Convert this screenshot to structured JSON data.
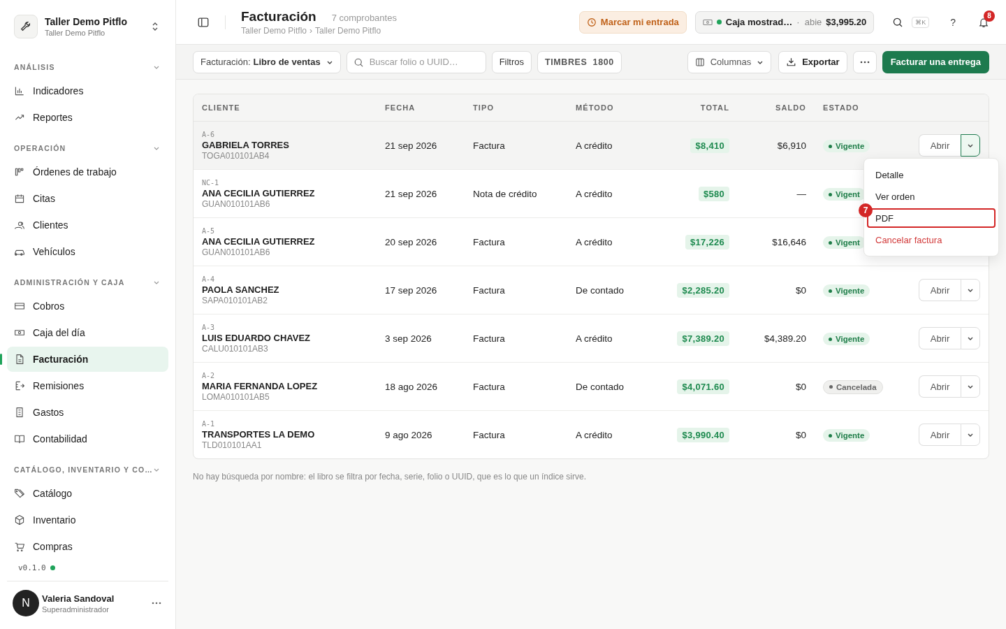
{
  "workspace": {
    "name": "Taller Demo Pitflo",
    "subtitle": "Taller Demo Pitflo"
  },
  "sidebar": {
    "sections": [
      {
        "title": "ANÁLISIS",
        "expanded": true,
        "items": [
          {
            "label": "Indicadores",
            "selected": false
          },
          {
            "label": "Reportes",
            "selected": false
          }
        ]
      },
      {
        "title": "OPERACIÓN",
        "expanded": true,
        "items": [
          {
            "label": "Órdenes de trabajo",
            "selected": false
          },
          {
            "label": "Citas",
            "selected": false
          },
          {
            "label": "Clientes",
            "selected": false
          },
          {
            "label": "Vehículos",
            "selected": false
          }
        ]
      },
      {
        "title": "ADMINISTRACIÓN Y CAJA",
        "expanded": true,
        "items": [
          {
            "label": "Cobros",
            "selected": false
          },
          {
            "label": "Caja del día",
            "selected": false
          },
          {
            "label": "Facturación",
            "selected": true
          },
          {
            "label": "Remisiones",
            "selected": false
          },
          {
            "label": "Gastos",
            "selected": false
          },
          {
            "label": "Contabilidad",
            "selected": false
          }
        ]
      },
      {
        "title": "CATÁLOGO, INVENTARIO Y CO…",
        "expanded": true,
        "items": [
          {
            "label": "Catálogo",
            "selected": false
          },
          {
            "label": "Inventario",
            "selected": false
          },
          {
            "label": "Compras",
            "selected": false
          }
        ]
      }
    ],
    "version": "v0.1.0",
    "user": {
      "initial": "N",
      "name": "Valeria Sandoval",
      "role": "Superadministrador"
    }
  },
  "header": {
    "title": "Facturación",
    "count": "7 comprobantes",
    "breadcrumb": [
      "Taller Demo Pitflo",
      "Taller Demo Pitflo"
    ],
    "breadcrumb_separator": "›",
    "clock_in": "Marcar mi entrada",
    "register": {
      "name": "Caja mostrad…",
      "separator": "·",
      "status": "abie",
      "amount": "$3,995.20"
    },
    "shortcut": "⌘K",
    "help": "?",
    "notifications": "8"
  },
  "toolbar": {
    "view_label": "Facturación:",
    "view_value": "Libro de ventas",
    "search": {
      "placeholder": "Buscar folio o UUID…"
    },
    "filters": "Filtros",
    "stamps_label": "TIMBRES",
    "stamps_value": "1800",
    "columns": "Columnas",
    "export": "Exportar",
    "primary": "Facturar una entrega"
  },
  "table": {
    "columns": [
      "CLIENTE",
      "FECHA",
      "TIPO",
      "MÉTODO",
      "TOTAL",
      "SALDO",
      "ESTADO"
    ],
    "rows": [
      {
        "folio": "A-6",
        "client": "GABRIELA TORRES",
        "rfc": "TOGA010101AB4",
        "date": "21 sep 2026",
        "type": "Factura",
        "method": "A crédito",
        "total": "$8,410",
        "balance": "$6,910",
        "status": "Vigente",
        "cancelled": false,
        "selected": true,
        "open": "Abrir"
      },
      {
        "folio": "NC-1",
        "client": "ANA CECILIA GUTIERREZ",
        "rfc": "GUAN010101AB6",
        "date": "21 sep 2026",
        "type": "Nota de crédito",
        "method": "A crédito",
        "total": "$580",
        "balance": "—",
        "status": "Vigent",
        "cancelled": false,
        "selected": false
      },
      {
        "folio": "A-5",
        "client": "ANA CECILIA GUTIERREZ",
        "rfc": "GUAN010101AB6",
        "date": "20 sep 2026",
        "type": "Factura",
        "method": "A crédito",
        "total": "$17,226",
        "balance": "$16,646",
        "status": "Vigent",
        "cancelled": false,
        "selected": false
      },
      {
        "folio": "A-4",
        "client": "PAOLA SANCHEZ",
        "rfc": "SAPA010101AB2",
        "date": "17 sep 2026",
        "type": "Factura",
        "method": "De contado",
        "total": "$2,285.20",
        "balance": "$0",
        "status": "Vigente",
        "cancelled": false,
        "selected": false,
        "open": "Abrir"
      },
      {
        "folio": "A-3",
        "client": "LUIS EDUARDO CHAVEZ",
        "rfc": "CALU010101AB3",
        "date": "3 sep 2026",
        "type": "Factura",
        "method": "A crédito",
        "total": "$7,389.20",
        "balance": "$4,389.20",
        "status": "Vigente",
        "cancelled": false,
        "selected": false,
        "open": "Abrir"
      },
      {
        "folio": "A-2",
        "client": "MARIA FERNANDA LOPEZ",
        "rfc": "LOMA010101AB5",
        "date": "18 ago 2026",
        "type": "Factura",
        "method": "De contado",
        "total": "$4,071.60",
        "balance": "$0",
        "status": "Cancelada",
        "cancelled": true,
        "selected": false,
        "open": "Abrir"
      },
      {
        "folio": "A-1",
        "client": "TRANSPORTES LA DEMO",
        "rfc": "TLD010101AA1",
        "date": "9 ago 2026",
        "type": "Factura",
        "method": "A crédito",
        "total": "$3,990.40",
        "balance": "$0",
        "status": "Vigente",
        "cancelled": false,
        "selected": false,
        "open": "Abrir"
      }
    ]
  },
  "footnote": "No hay búsqueda por nombre: el libro se filtra por fecha, serie, folio o UUID, que es lo que un índice sirve.",
  "row_menu": {
    "items": [
      {
        "label": "Detalle",
        "kind": "normal",
        "selected": false
      },
      {
        "label": "Ver orden",
        "kind": "normal",
        "selected": false
      },
      {
        "label": "PDF",
        "kind": "normal",
        "selected": true
      },
      {
        "label": "Cancelar factura",
        "kind": "danger",
        "selected": false
      }
    ],
    "step_badge": "7"
  }
}
